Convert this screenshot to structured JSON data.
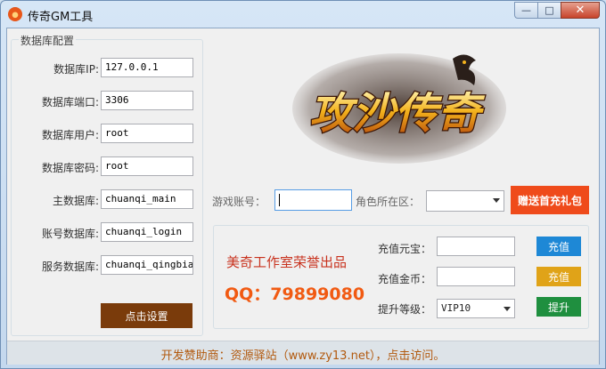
{
  "window": {
    "title": "传奇GM工具",
    "controls": {
      "minimize": "—",
      "maximize": "□",
      "close": "✕"
    }
  },
  "db_config": {
    "group_title": "数据库配置",
    "fields": [
      {
        "label": "数据库IP:",
        "value": "127.0.0.1"
      },
      {
        "label": "数据库端口:",
        "value": "3306"
      },
      {
        "label": "数据库用户:",
        "value": "root"
      },
      {
        "label": "数据库密码:",
        "value": "root"
      },
      {
        "label": "主数据库:",
        "value": "chuanqi_main"
      },
      {
        "label": "账号数据库:",
        "value": "chuanqi_login"
      },
      {
        "label": "服务数据库:",
        "value": "chuanqi_qingbiao"
      }
    ],
    "set_button": "点击设置"
  },
  "logo": {
    "text": "攻沙传奇"
  },
  "account": {
    "account_label": "游戏账号：",
    "account_value": "",
    "zone_label": "角色所在区：",
    "zone_value": "",
    "gift_button": "赠送首充礼包"
  },
  "panel": {
    "studio_text": "美奇工作室荣誉出品",
    "qq_text": "QQ：79899080",
    "recharge_ingot": {
      "label": "充值元宝：",
      "value": "",
      "button": "充值"
    },
    "recharge_gold": {
      "label": "充值金币：",
      "value": "",
      "button": "充值"
    },
    "upgrade": {
      "label": "提升等级：",
      "value": "VIP10",
      "button": "提升"
    }
  },
  "footer": {
    "text": "开发赞助商：资源驿站（www.zy13.net），点击访问。"
  },
  "colors": {
    "set_button": "#7a3b0b",
    "gift_button": "#ef4b1b",
    "qq": "#f15a12",
    "studio": "#c8321e",
    "btn_blue": "#1e88d6",
    "btn_gold": "#e0a318",
    "btn_green": "#1f8f3f",
    "footer_text": "#b25a0f"
  }
}
